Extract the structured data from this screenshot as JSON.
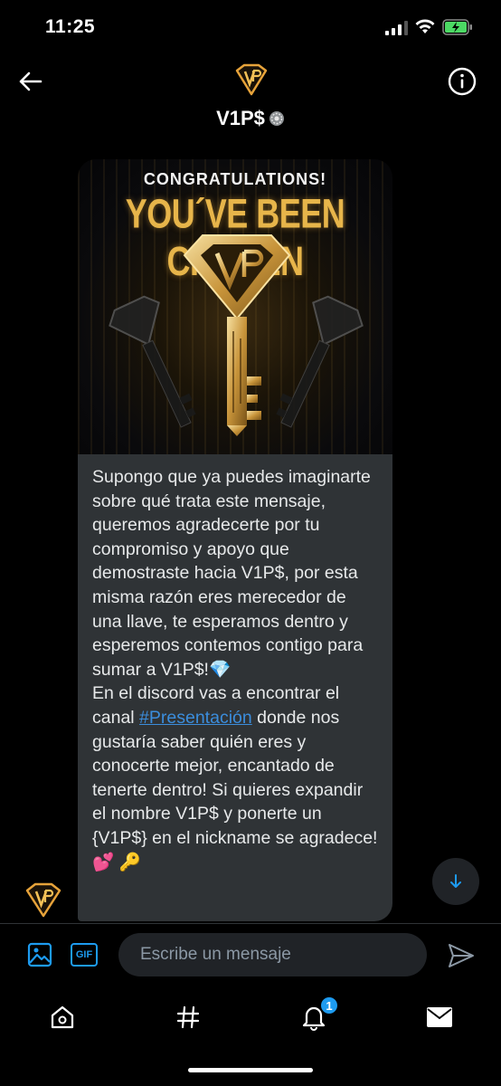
{
  "status_bar": {
    "time": "11:25"
  },
  "header": {
    "title": "V1P$"
  },
  "message": {
    "image_text": {
      "congrats": "CONGRATULATIONS!",
      "headline": "YOU´VE BEEN CHOSEN"
    },
    "text_part1": "Supongo que ya puedes imaginarte sobre qué trata este mensaje, queremos agradecerte por tu compromiso y apoyo que demostraste hacia V1P$, por esta misma razón eres merecedor de una llave, te esperamos dentro y esperemos contemos contigo para sumar a V1P$!💎",
    "text_part2_pre": "En el discord vas a encontrar el canal ",
    "link": "#Presentación",
    "text_part2_post": " donde nos gustaría saber quién eres y conocerte mejor, encantado de tenerte dentro! Si quieres expandir el nombre V1P$ y ponerte un {V1P$} en el nickname se agradece! 💕 🔑"
  },
  "composer": {
    "gif_label": "GIF",
    "placeholder": "Escribe un mensaje"
  },
  "tabbar": {
    "notification_count": "1"
  },
  "colors": {
    "accent": "#1d9bf0",
    "bubble_bg": "#2f3336",
    "gold": "#e7b54a",
    "background": "#000000"
  },
  "icons": [
    "back-arrow-icon",
    "info-icon",
    "verified-badge-icon",
    "image-icon",
    "send-icon",
    "home-icon",
    "explore-hashtag-icon",
    "bell-icon",
    "mail-icon",
    "arrow-down-icon"
  ]
}
